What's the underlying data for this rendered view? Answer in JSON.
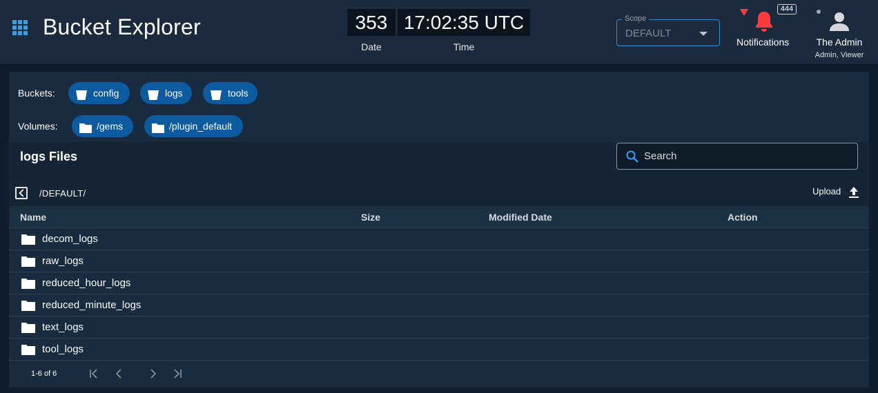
{
  "header": {
    "title": "Bucket Explorer",
    "date_value": "353",
    "date_label": "Date",
    "time_value": "17:02:35 UTC",
    "time_label": "Time",
    "scope_label": "Scope",
    "scope_value": "DEFAULT",
    "notifications_label": "Notifications",
    "notifications_count": "444",
    "user_name": "The Admin",
    "user_roles": "Admin, Viewer"
  },
  "buckets": {
    "label": "Buckets:",
    "items": [
      "config",
      "logs",
      "tools"
    ]
  },
  "volumes": {
    "label": "Volumes:",
    "items": [
      "/gems",
      "/plugin_default"
    ]
  },
  "files": {
    "title": "logs Files",
    "search_placeholder": "Search",
    "path": "/DEFAULT/",
    "upload_label": "Upload",
    "columns": [
      "Name",
      "Size",
      "Modified Date",
      "Action"
    ],
    "rows": [
      {
        "name": "decom_logs"
      },
      {
        "name": "raw_logs"
      },
      {
        "name": "reduced_hour_logs"
      },
      {
        "name": "reduced_minute_logs"
      },
      {
        "name": "text_logs"
      },
      {
        "name": "tool_logs"
      }
    ],
    "pagination": "1-6 of 6"
  },
  "colors": {
    "accent": "#3b8dd1",
    "chip": "#0c5aa0",
    "alert": "#ff3b3b"
  },
  "icons": {
    "apps": "apps-grid-icon",
    "bucket": "bucket-icon",
    "folder": "folder-icon",
    "bell": "bell-icon",
    "user": "account-icon",
    "search": "search-icon",
    "upload": "upload-icon"
  }
}
